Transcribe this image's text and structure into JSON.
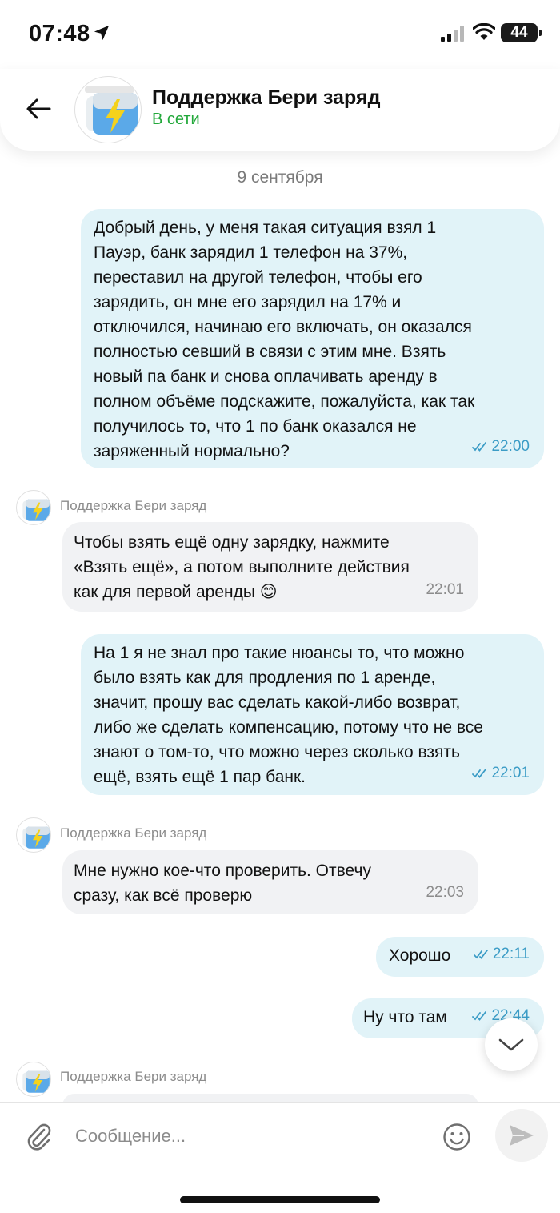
{
  "status_bar": {
    "time": "07:48",
    "battery": "44",
    "icons": [
      "location-arrow-icon",
      "cellular-signal-icon",
      "wifi-icon",
      "battery-icon"
    ]
  },
  "header": {
    "title": "Поддержка Бери заряд",
    "status": "В сети",
    "status_color": "#22a83a",
    "back_icon": "arrow-left-icon",
    "avatar_icon": "battery-bolt-icon"
  },
  "chat": {
    "date": "9 сентября",
    "messages": [
      {
        "direction": "out",
        "lines": [
          "Добрый день, у меня такая ситуация взял 1",
          "Пауэр, банк зарядил 1 телефон на 37%,",
          "переставил на другой телефон, чтобы его",
          "зарядить, он мне его зарядил на 17% и",
          "отключился, начинаю его включать, он оказался",
          "полностью севший в связи с этим мне. Взять",
          "новый па банк и снова оплачивать аренду в",
          "полном объёме подскажите, пожалуйста, как так",
          "получилось то, что 1 по банк оказался не",
          "заряженный нормально?"
        ],
        "time": "22:00"
      },
      {
        "direction": "in",
        "sender": "Поддержка Бери заряд",
        "lines": [
          "Чтобы взять ещё одну зарядку, нажмите",
          "«Взять ещё», а потом выполните действия",
          "как для первой аренды 😊"
        ],
        "time": "22:01"
      },
      {
        "direction": "out",
        "lines": [
          "На 1 я не знал про такие нюансы то, что можно",
          "было взять как для продления по 1 аренде,",
          "значит, прошу вас сделать какой-либо возврат,",
          "либо же сделать компенсацию, потому что не все",
          "знают о том-то, что можно через сколько взять",
          "ещё, взять ещё 1 пар банк."
        ],
        "time": "22:01"
      },
      {
        "direction": "in",
        "sender": "Поддержка Бери заряд",
        "lines": [
          "Мне нужно кое-что проверить. Отвечу",
          "сразу, как всё проверю"
        ],
        "time": "22:03"
      },
      {
        "direction": "out",
        "lines": [
          "Хорошо"
        ],
        "time": "22:11"
      },
      {
        "direction": "out",
        "lines": [
          "Ну что там"
        ],
        "time": "22:44"
      },
      {
        "direction": "in",
        "sender": "Поддержка Бери заряд",
        "lines": [],
        "time": ""
      }
    ]
  },
  "composer": {
    "placeholder": "Сообщение...",
    "attach_icon": "paperclip-icon",
    "emoji_icon": "smiley-icon",
    "send_icon": "send-arrow-icon"
  },
  "colors": {
    "outgoing_bubble": "#e1f3f8",
    "incoming_bubble": "#f1f2f4",
    "read_ticks": "#3b9cc6",
    "online_status": "#22a83a"
  }
}
